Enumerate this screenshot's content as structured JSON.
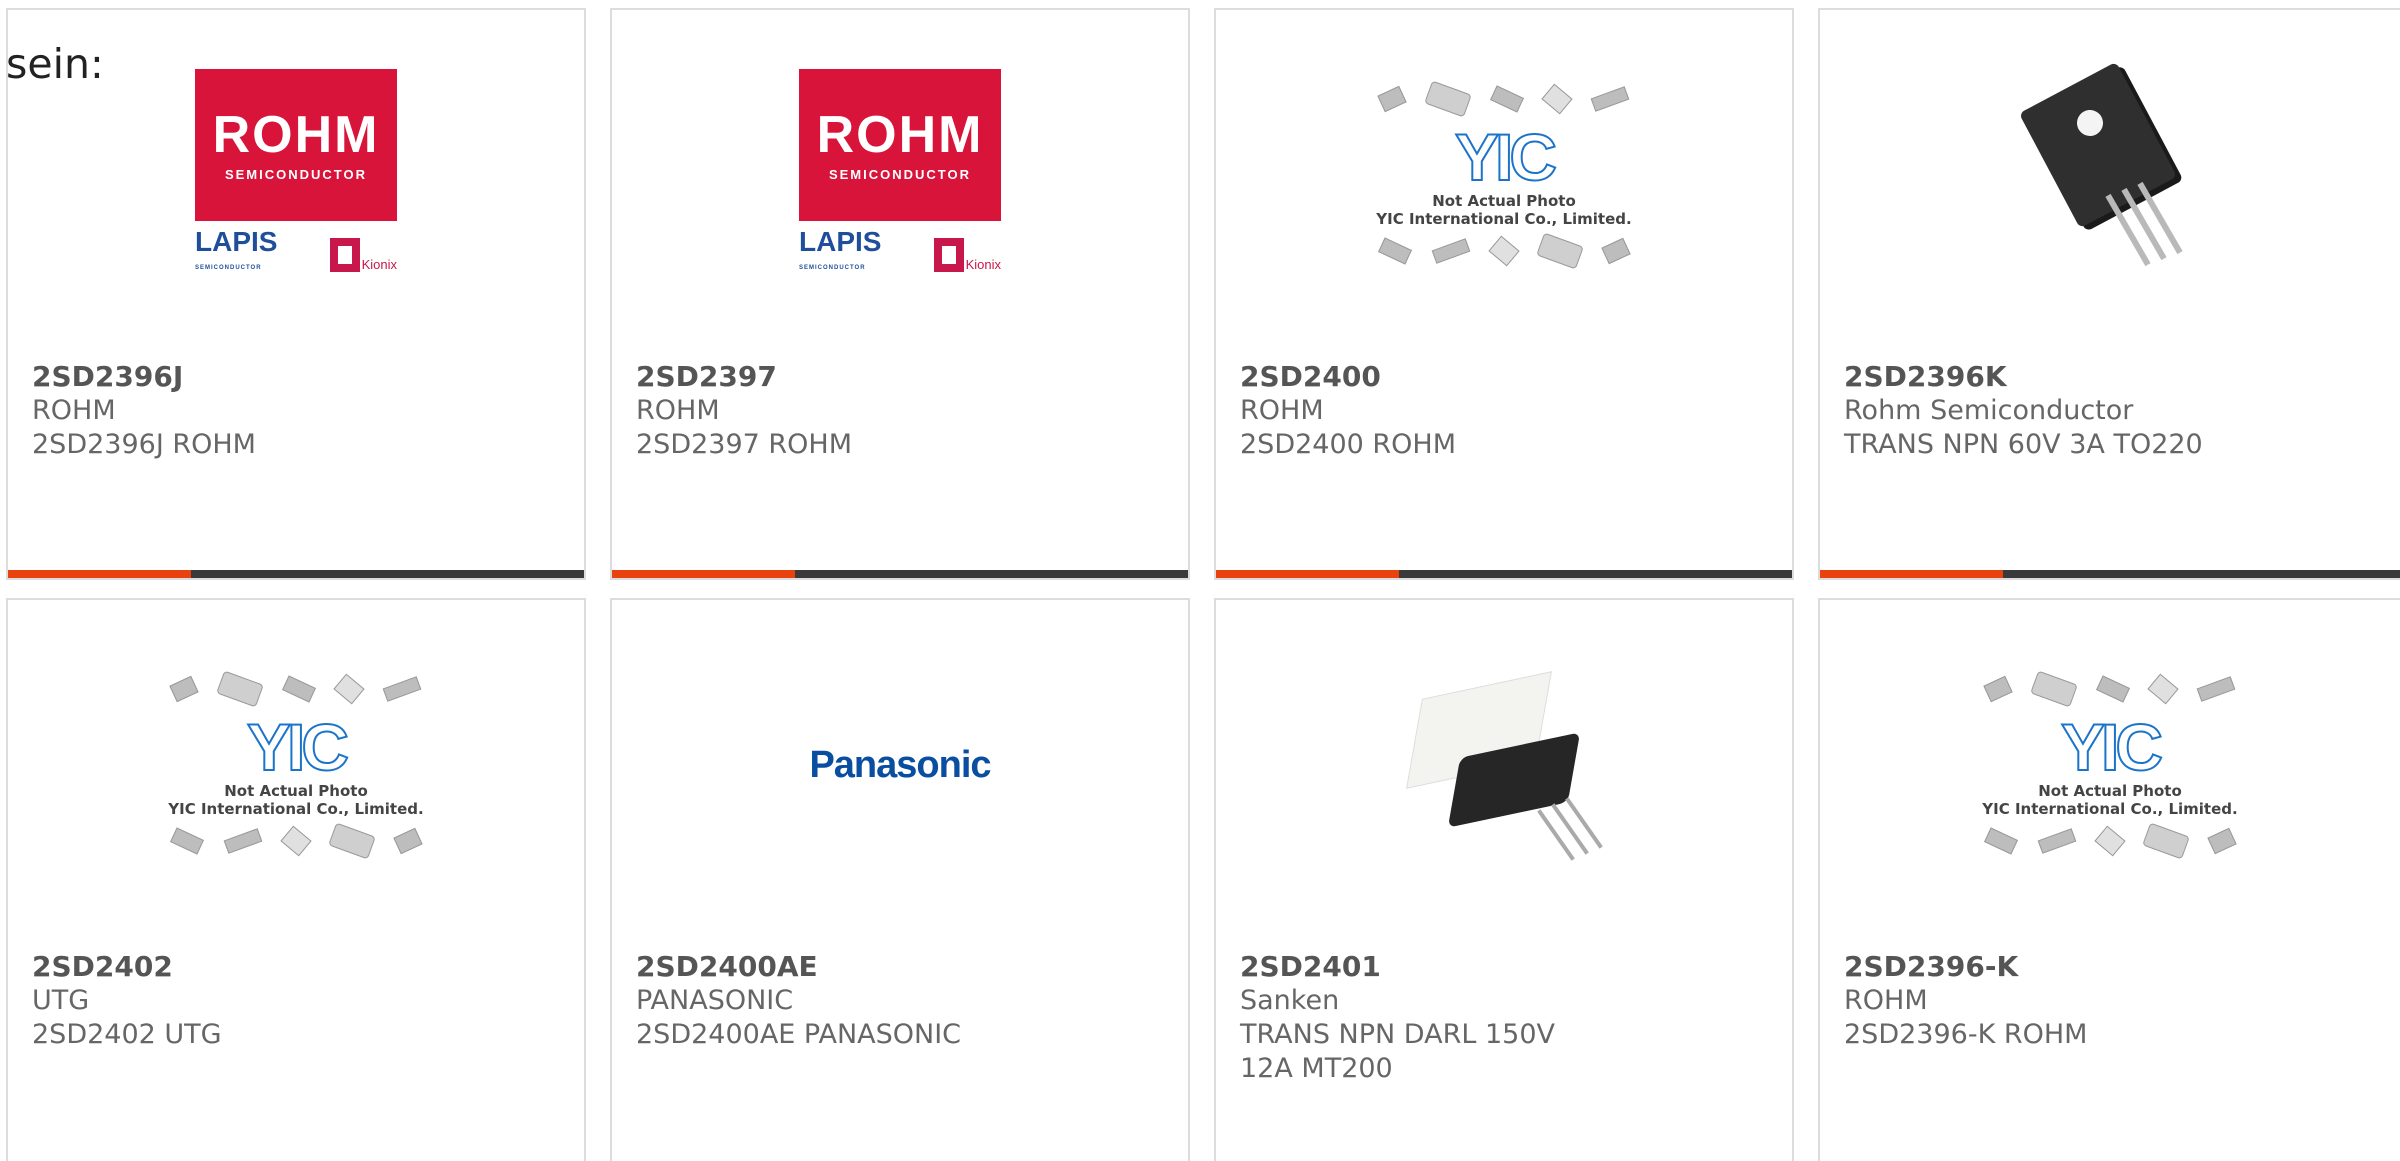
{
  "intro_text": "sein:",
  "colors": {
    "accent_bar": "#e8420f",
    "bar_rest": "#3a3a3a",
    "rohm_red": "#d8143a",
    "panasonic_blue": "#0a4ea2",
    "yic_blue": "#1b74c9"
  },
  "products": [
    {
      "part": "2SD2396J",
      "manufacturer": "ROHM",
      "description": "2SD2396J ROHM",
      "image": "rohm-logo"
    },
    {
      "part": "2SD2397",
      "manufacturer": "ROHM",
      "description": "2SD2397 ROHM",
      "image": "rohm-logo"
    },
    {
      "part": "2SD2400",
      "manufacturer": "ROHM",
      "description": "2SD2400 ROHM",
      "image": "yic-placeholder"
    },
    {
      "part": "2SD2396K",
      "manufacturer": "Rohm Semiconductor",
      "description": "TRANS NPN 60V 3A TO220",
      "image": "to220-photo"
    },
    {
      "part": "2SD2402",
      "manufacturer": "UTG",
      "description": "2SD2402 UTG",
      "image": "yic-placeholder"
    },
    {
      "part": "2SD2400AE",
      "manufacturer": "PANASONIC",
      "description": "2SD2400AE PANASONIC",
      "image": "panasonic-logo"
    },
    {
      "part": "2SD2401",
      "manufacturer": "Sanken",
      "description": "TRANS NPN DARL 150V 12A MT200",
      "image": "mt200-photo"
    },
    {
      "part": "2SD2396-K",
      "manufacturer": "ROHM",
      "description": "2SD2396-K ROHM",
      "image": "yic-placeholder"
    }
  ],
  "logos": {
    "rohm": {
      "word": "ROHM",
      "sub": "SEMICONDUCTOR",
      "lapis": "LAPIS",
      "lapis_sub": "SEMICONDUCTOR",
      "kionix": "Kionix"
    },
    "yic": {
      "mark": "YIC",
      "line1": "Not Actual Photo",
      "line2": "YIC International Co., Limited."
    },
    "panasonic": "Panasonic"
  }
}
